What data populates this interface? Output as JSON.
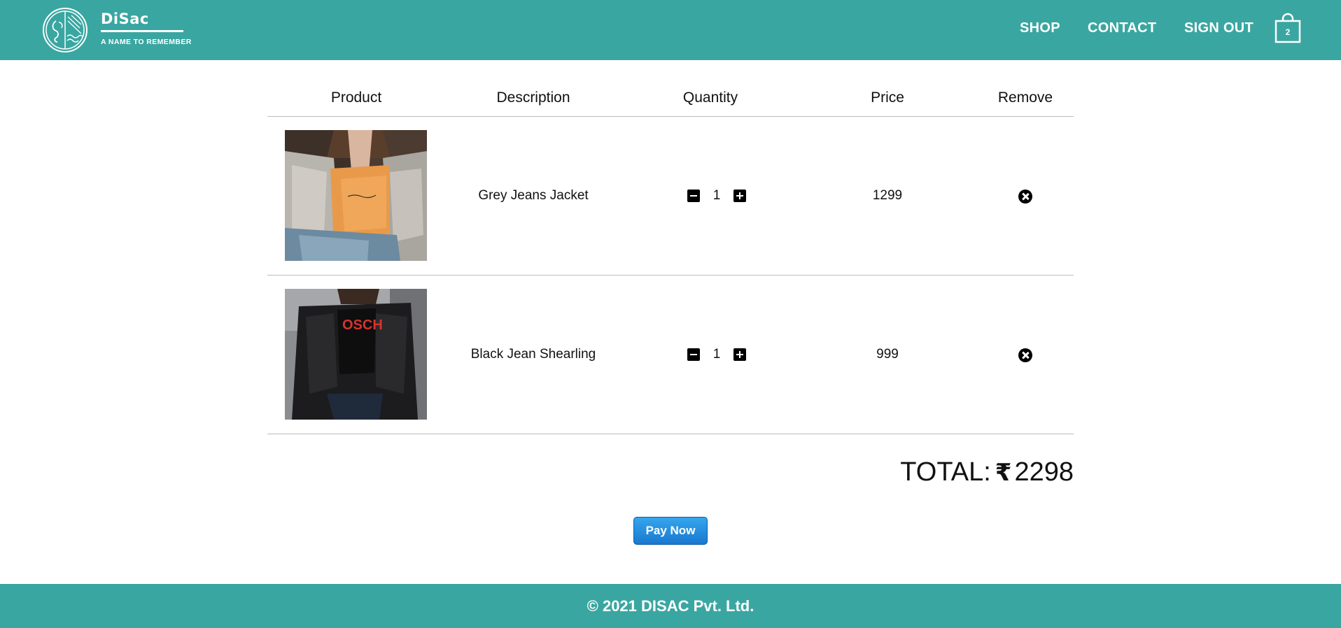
{
  "header": {
    "brand_name": "DiSac",
    "brand_tagline": "A NAME TO REMEMBER",
    "nav": {
      "shop": "SHOP",
      "contact": "CONTACT",
      "signout": "SIGN OUT"
    },
    "cart_count": "2"
  },
  "table": {
    "headers": [
      "Product",
      "Description",
      "Quantity",
      "Price",
      "Remove"
    ],
    "rows": [
      {
        "description": "Grey Jeans Jacket",
        "quantity": "1",
        "price": "1299"
      },
      {
        "description": "Black Jean Shearling",
        "quantity": "1",
        "price": "999"
      }
    ]
  },
  "total": {
    "label": "TOTAL:",
    "currency_icon": "rupee-icon",
    "amount": "2298"
  },
  "pay_button": "Pay Now",
  "footer": {
    "copyright": "© 2021 DISAC Pvt. Ltd."
  },
  "colors": {
    "brand": "#3aa6a1",
    "pay_button": "#1a78cf"
  }
}
